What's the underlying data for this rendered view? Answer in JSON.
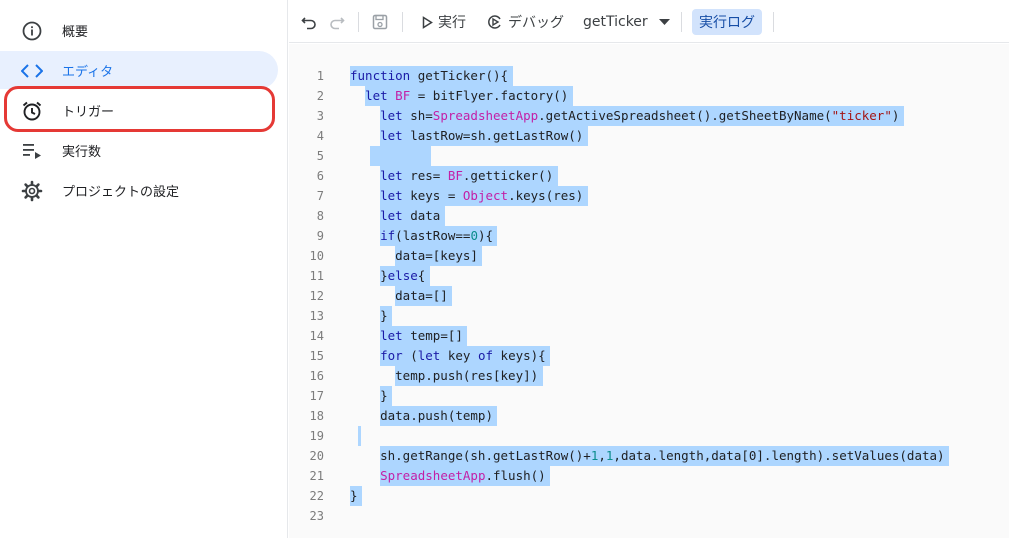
{
  "sidebar": {
    "items": [
      {
        "label": "概要",
        "icon": "info-icon"
      },
      {
        "label": "エディタ",
        "icon": "code-icon"
      },
      {
        "label": "トリガー",
        "icon": "alarm-clock-icon"
      },
      {
        "label": "実行数",
        "icon": "executions-list-icon"
      },
      {
        "label": "プロジェクトの設定",
        "icon": "gear-icon"
      }
    ],
    "active_index": 1,
    "highlighted_index": 2
  },
  "toolbar": {
    "undo_icon": "undo-icon",
    "redo_icon": "redo-icon",
    "save_icon": "save-icon",
    "run_label": "実行",
    "debug_label": "デバッグ",
    "function_select": "getTicker",
    "log_label": "実行ログ"
  },
  "editor": {
    "line_numbers": [
      "1",
      "2",
      "3",
      "4",
      "5",
      "6",
      "7",
      "8",
      "9",
      "10",
      "11",
      "12",
      "13",
      "14",
      "15",
      "16",
      "17",
      "18",
      "19",
      "20",
      "21",
      "22",
      "23"
    ],
    "lines": [
      "function getTicker(){",
      "  let BF = bitFlyer.factory()",
      "    let sh=SpreadsheetApp.getActiveSpreadsheet().getSheetByName(\"ticker\")",
      "    let lastRow=sh.getLastRow()",
      "",
      "    let res= BF.getticker()",
      "    let keys = Object.keys(res)",
      "    let data",
      "    if(lastRow==0){",
      "      data=[keys]",
      "    }else{",
      "      data=[]",
      "    }",
      "    let temp=[]",
      "    for (let key of keys){",
      "      temp.push(res[key])",
      "    }",
      "    data.push(temp)",
      "",
      "    sh.getRange(sh.getLastRow()+1,1,data.length,data[0].length).setValues(data)",
      "    SpreadsheetApp.flush()",
      "}",
      ""
    ]
  },
  "colors": {
    "selection": "#add6ff",
    "keyword": "#1a1aa6",
    "class": "#c31fa6",
    "string": "#a31515",
    "number": "#0b8c8c",
    "highlight_ring": "#e53935",
    "active_nav_bg": "#e8f0fe",
    "active_nav_text": "#1a73e8"
  }
}
